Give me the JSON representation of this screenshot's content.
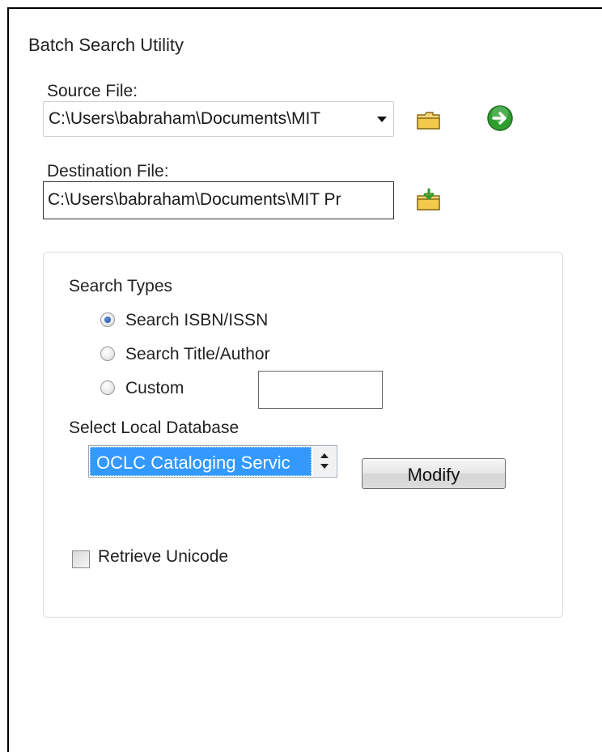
{
  "window": {
    "title": "Batch Search Utility"
  },
  "source": {
    "label": "Source File:",
    "value": "C:\\Users\\babraham\\Documents\\MIT"
  },
  "destination": {
    "label": "Destination File:",
    "value": "C:\\Users\\babraham\\Documents\\MIT Pr"
  },
  "search_types": {
    "heading": "Search Types",
    "options": [
      {
        "label": "Search ISBN/ISSN",
        "checked": true
      },
      {
        "label": "Search Title/Author",
        "checked": false
      },
      {
        "label": "Custom",
        "checked": false
      }
    ],
    "custom_value": ""
  },
  "local_database": {
    "heading": "Select Local Database",
    "selected": "OCLC Cataloging Servic",
    "modify_label": "Modify"
  },
  "unicode": {
    "label": "Retrieve Unicode",
    "checked": false
  },
  "colors": {
    "selection": "#3399ff",
    "folder": "#f2c94c",
    "go": "#2e9e2e"
  }
}
